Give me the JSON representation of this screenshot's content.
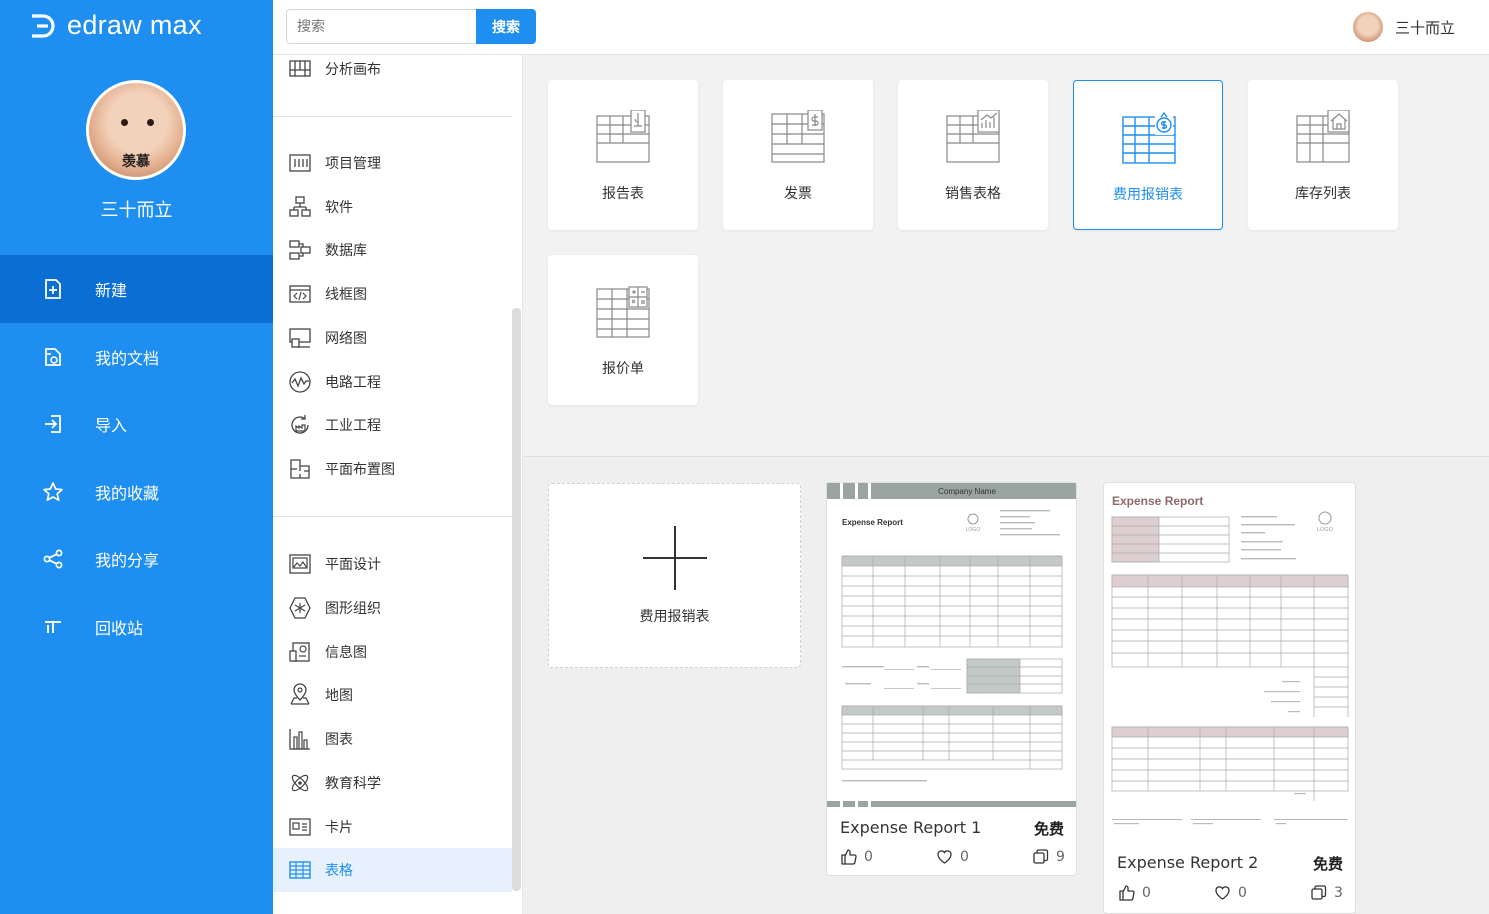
{
  "app": {
    "logo_text": "edraw max"
  },
  "profile": {
    "avatar_caption": "羡慕",
    "name": "三十而立"
  },
  "nav": [
    {
      "label": "新建",
      "icon": "new-file-icon",
      "active": true
    },
    {
      "label": "我的文档",
      "icon": "documents-icon",
      "active": false
    },
    {
      "label": "导入",
      "icon": "import-icon",
      "active": false
    },
    {
      "label": "我的收藏",
      "icon": "star-icon",
      "active": false
    },
    {
      "label": "我的分享",
      "icon": "share-icon",
      "active": false
    },
    {
      "label": "回收站",
      "icon": "trash-icon",
      "active": false
    }
  ],
  "search": {
    "placeholder": "搜索",
    "button": "搜索"
  },
  "header_user": {
    "name": "三十而立"
  },
  "categories": {
    "group1": [
      {
        "label": "分析画布",
        "icon": "canvas-icon"
      }
    ],
    "group2": [
      {
        "label": "项目管理",
        "icon": "project-icon"
      },
      {
        "label": "软件",
        "icon": "software-icon"
      },
      {
        "label": "数据库",
        "icon": "database-icon"
      },
      {
        "label": "线框图",
        "icon": "wireframe-icon"
      },
      {
        "label": "网络图",
        "icon": "network-icon"
      },
      {
        "label": "电路工程",
        "icon": "circuit-icon"
      },
      {
        "label": "工业工程",
        "icon": "industrial-icon"
      },
      {
        "label": "平面布置图",
        "icon": "floorplan-icon"
      }
    ],
    "group3": [
      {
        "label": "平面设计",
        "icon": "graphic-design-icon"
      },
      {
        "label": "图形组织",
        "icon": "graphic-organizer-icon"
      },
      {
        "label": "信息图",
        "icon": "infographic-icon"
      },
      {
        "label": "地图",
        "icon": "map-icon"
      },
      {
        "label": "图表",
        "icon": "chart-icon"
      },
      {
        "label": "教育科学",
        "icon": "science-icon"
      },
      {
        "label": "卡片",
        "icon": "card-icon"
      },
      {
        "label": "表格",
        "icon": "table-icon",
        "active": true
      }
    ]
  },
  "table_types": [
    {
      "label": "报告表",
      "icon": "report-table-icon"
    },
    {
      "label": "发票",
      "icon": "invoice-icon"
    },
    {
      "label": "销售表格",
      "icon": "sales-table-icon"
    },
    {
      "label": "费用报销表",
      "icon": "expense-table-icon",
      "selected": true
    },
    {
      "label": "库存列表",
      "icon": "inventory-icon"
    },
    {
      "label": "报价单",
      "icon": "quote-icon"
    }
  ],
  "new_blank": {
    "label": "费用报销表"
  },
  "templates": [
    {
      "name": "Expense Report 1",
      "price": "免费",
      "likes": "0",
      "favorites": "0",
      "copies": "9",
      "thumb": {
        "header": "Company Name",
        "title": "Expense Report",
        "logo": "LOGO"
      }
    },
    {
      "name": "Expense Report 2",
      "price": "免费",
      "likes": "0",
      "favorites": "0",
      "copies": "3",
      "thumb": {
        "title": "Expense Report",
        "logo": "LOGO"
      }
    }
  ],
  "colors": {
    "primary": "#1f8ef1",
    "nav_active": "#0a6ed3",
    "cat_active_bg": "#e6f1fd"
  }
}
